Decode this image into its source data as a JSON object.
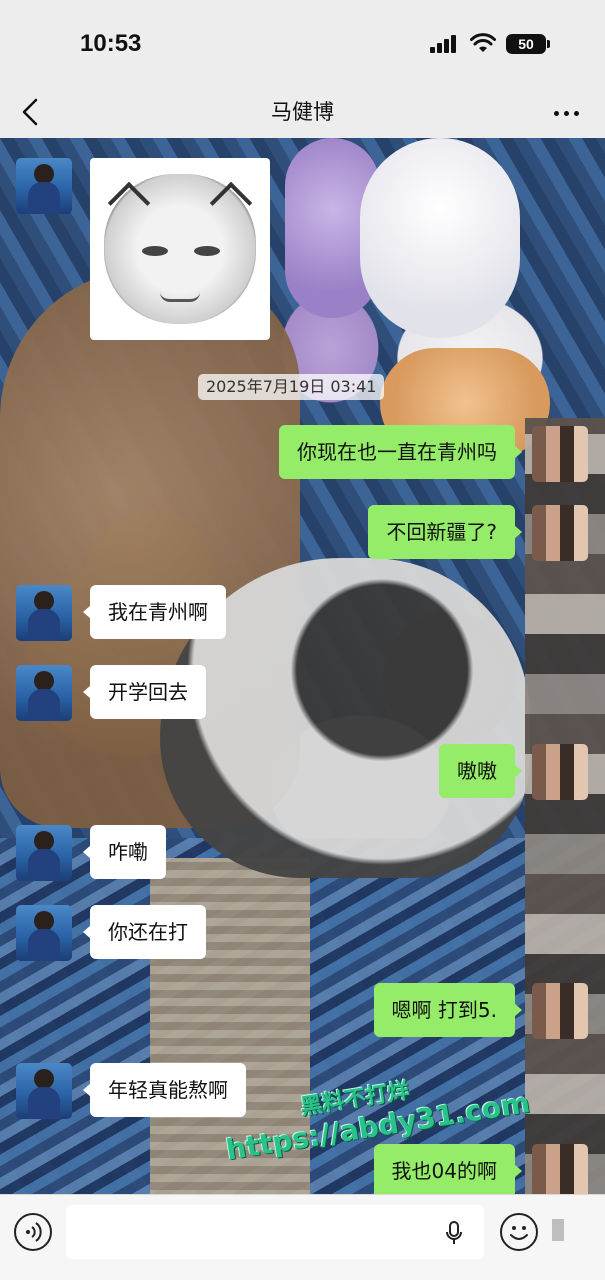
{
  "status_bar": {
    "time": "10:53",
    "battery": "50"
  },
  "nav": {
    "title": "马健博"
  },
  "chat": {
    "timestamp": "2025年7月19日 03:41",
    "messages": [
      {
        "side": "right",
        "text": "你现在也一直在青州吗"
      },
      {
        "side": "right",
        "text": "不回新疆了?"
      },
      {
        "side": "left",
        "text": "我在青州啊"
      },
      {
        "side": "left",
        "text": "开学回去"
      },
      {
        "side": "right",
        "text": "嗷嗷"
      },
      {
        "side": "left",
        "text": "咋嘞"
      },
      {
        "side": "left",
        "text": "你还在打"
      },
      {
        "side": "right",
        "text": "嗯啊 打到5."
      },
      {
        "side": "left",
        "text": "年轻真能熬啊"
      },
      {
        "side": "right",
        "text": "我也04的啊"
      }
    ]
  },
  "watermark": {
    "line1": "黑料不打烊",
    "line2": "https://abdy31.com"
  },
  "colors": {
    "sent_bubble": "#95ec69",
    "received_bubble": "#ffffff",
    "bar_background": "#ededed"
  }
}
